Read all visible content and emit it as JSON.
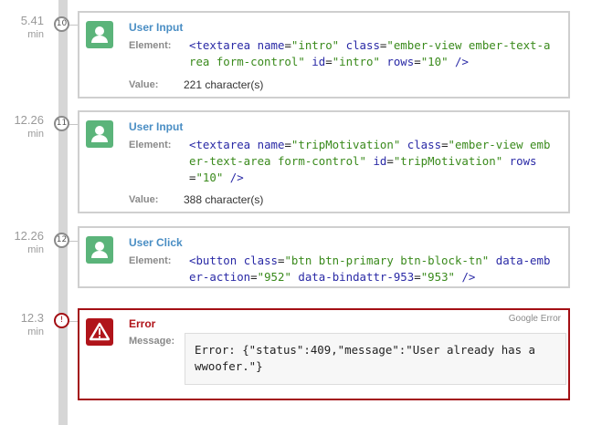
{
  "events": [
    {
      "time": "5.41",
      "unit": "min",
      "index": "10",
      "title": "User Input",
      "element_label": "Element:",
      "code": {
        "tag_open": "<textarea",
        "attrs": [
          {
            "name": "name",
            "value": "\"intro\""
          },
          {
            "name": "class",
            "value": "\"ember-view ember-text-area form-control\""
          },
          {
            "name": "id",
            "value": "\"intro\""
          },
          {
            "name": "rows",
            "value": "\"10\""
          }
        ],
        "tag_close": "/>"
      },
      "value_label": "Value:",
      "value": "221 character(s)"
    },
    {
      "time": "12.26",
      "unit": "min",
      "index": "11",
      "title": "User Input",
      "element_label": "Element:",
      "code": {
        "tag_open": "<textarea",
        "attrs": [
          {
            "name": "name",
            "value": "\"tripMotivation\""
          },
          {
            "name": "class",
            "value": "\"ember-view ember-text-area form-control\""
          },
          {
            "name": "id",
            "value": "\"tripMotivation\""
          },
          {
            "name": "rows",
            "value": "\"10\""
          }
        ],
        "tag_close": "/>"
      },
      "value_label": "Value:",
      "value": "388 character(s)"
    },
    {
      "time": "12.26",
      "unit": "min",
      "index": "12",
      "title": "User Click",
      "element_label": "Element:",
      "code": {
        "tag_open": "<button",
        "attrs": [
          {
            "name": "class",
            "value": "\"btn btn-primary btn-block-tn\""
          },
          {
            "name": "data-ember-action",
            "value": "\"952\""
          },
          {
            "name": "data-bindattr-953",
            "value": "\"953\""
          }
        ],
        "tag_close": "/>"
      }
    }
  ],
  "error_event": {
    "time": "12.3",
    "unit": "min",
    "marker": "!",
    "title": "Error",
    "source": "Google Error",
    "message_label": "Message:",
    "message": "Error: {\"status\":409,\"message\":\"User already has a wwoofer.\"}"
  },
  "colors": {
    "user_accent": "#5bb47a",
    "error_accent": "#b0141a",
    "title_blue": "#4a8ec4"
  }
}
